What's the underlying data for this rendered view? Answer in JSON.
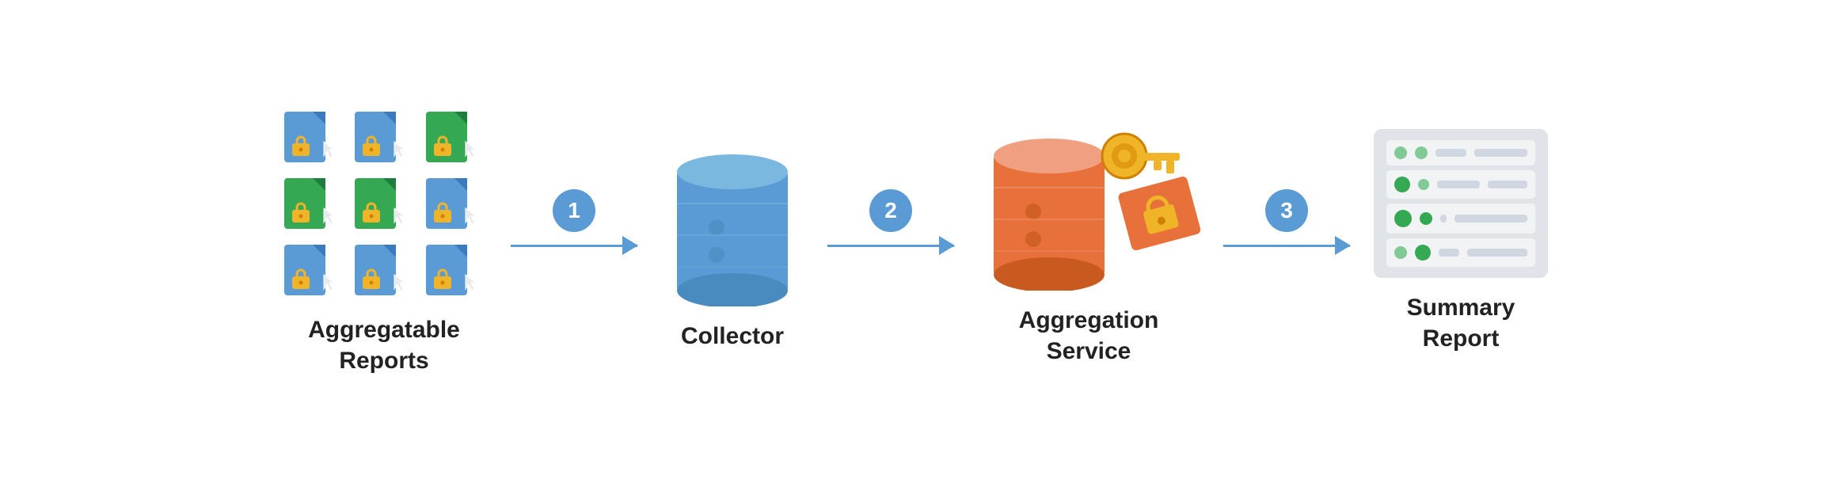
{
  "diagram": {
    "nodes": [
      {
        "id": "aggregatable-reports",
        "label_line1": "Aggregatable",
        "label_line2": "Reports"
      },
      {
        "id": "collector",
        "label_line1": "Collector",
        "label_line2": ""
      },
      {
        "id": "aggregation-service",
        "label_line1": "Aggregation",
        "label_line2": "Service"
      },
      {
        "id": "summary-report",
        "label_line1": "Summary",
        "label_line2": "Report"
      }
    ],
    "arrows": [
      {
        "step": "1"
      },
      {
        "step": "2"
      },
      {
        "step": "3"
      }
    ]
  },
  "colors": {
    "blue_step": "#5b9bd5",
    "db_blue": "#5b9bd5",
    "db_blue_top": "#7ab8e0",
    "db_orange": "#e8703a",
    "db_orange_top": "#f0a080",
    "key_yellow": "#f0b429",
    "lock_orange": "#e8703a",
    "doc_blue": "#5b9bd5",
    "doc_blue_dark": "#3a7abf",
    "doc_green": "#34a853",
    "doc_green_dark": "#1e7e3e",
    "lock_yellow": "#f0b429",
    "dot_green": "#34a853",
    "dot_green_light": "#81c995",
    "summary_bg": "#e8eaed",
    "summary_row_bg": "#f1f3f4"
  }
}
